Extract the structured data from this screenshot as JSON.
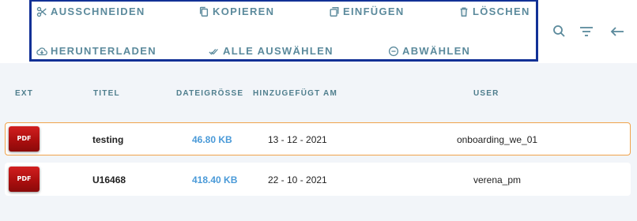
{
  "toolbar": {
    "cut_label": "AUSSCHNEIDEN",
    "copy_label": "KOPIEREN",
    "paste_label": "EINFÜGEN",
    "delete_label": "LÖSCHEN",
    "download_label": "HERUNTERLADEN",
    "select_all_label": "ALLE AUSWÄHLEN",
    "deselect_label": "ABWÄHLEN",
    "accent_color": "#123196",
    "text_color": "#5b8a9c"
  },
  "header_icons": [
    "search-icon",
    "filter-icon",
    "back-arrow-icon"
  ],
  "table": {
    "columns": {
      "ext": "EXT",
      "title": "TITEL",
      "size": "DATEIGRÖSSE",
      "date": "HINZUGEFÜGT AM",
      "user": "USER"
    },
    "rows": [
      {
        "ext": "PDF",
        "title": "testing",
        "size": "46.80 KB",
        "date": "13 - 12 - 2021",
        "user": "onboarding_we_01",
        "selected": true
      },
      {
        "ext": "PDF",
        "title": "U16468",
        "size": "418.40 KB",
        "date": "22 - 10 - 2021",
        "user": "verena_pm",
        "selected": false
      }
    ],
    "size_color": "#4a9ad8",
    "selected_border_color": "#f0a34b"
  }
}
